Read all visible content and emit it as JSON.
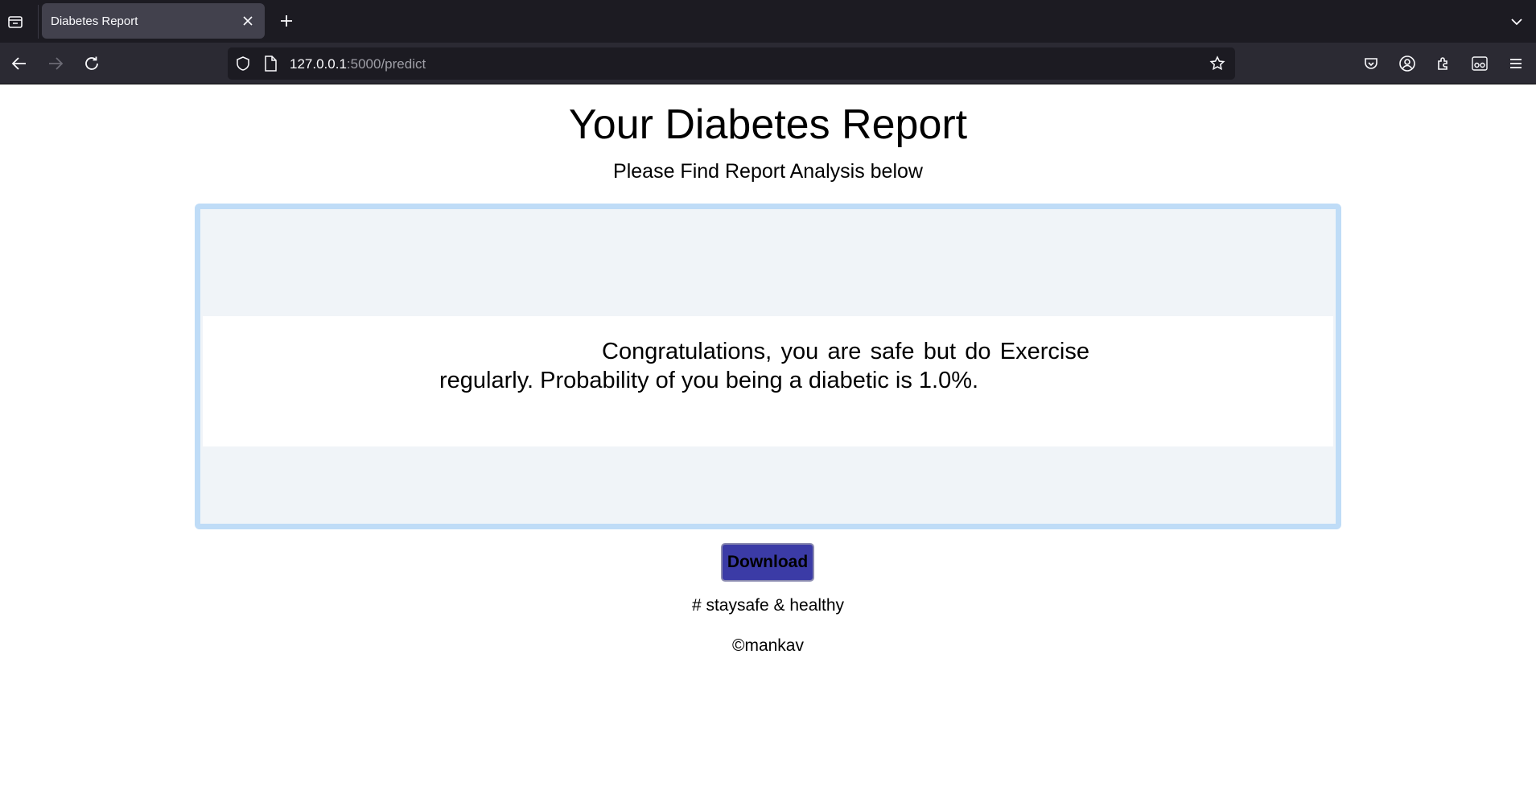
{
  "browser": {
    "tab_title": "Diabetes Report",
    "url_host": "127.0.0.1",
    "url_rest": ":5000/predict"
  },
  "page": {
    "title": "Your Diabetes Report",
    "subtitle": "Please Find Report Analysis below",
    "report_text": "Congratulations, you are safe but do Exercise regularly. Probability of you being a diabetic is 1.0%.",
    "download_label": "Download",
    "tagline": "# staysafe & healthy",
    "copyright": "©mankav"
  },
  "colors": {
    "chrome_dark": "#1c1b22",
    "toolbar": "#2b2a33",
    "active_tab": "#42414d",
    "report_border": "#bfdcf7",
    "report_bg": "#f0f4f8",
    "download_button": "#3b3ba6"
  }
}
